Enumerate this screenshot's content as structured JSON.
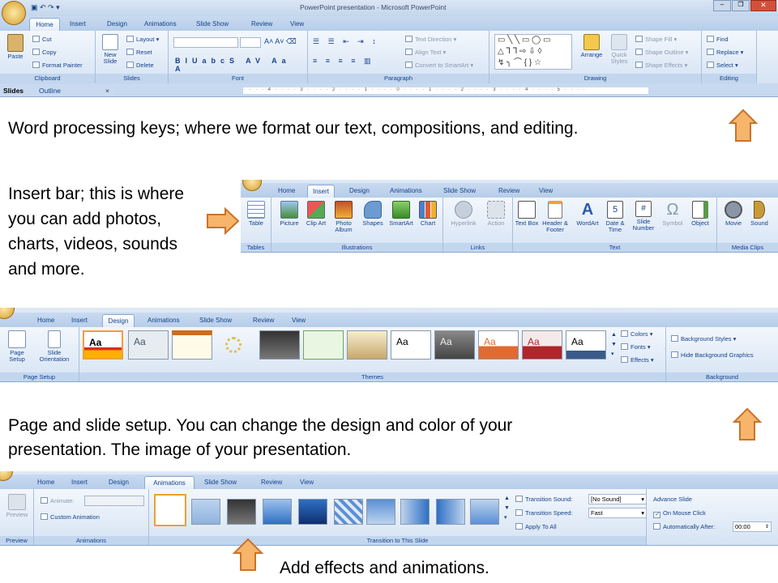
{
  "window": {
    "title": "PowerPoint presentation - Microsoft PowerPoint"
  },
  "ribbon1": {
    "tabs": [
      "Home",
      "Insert",
      "Design",
      "Animations",
      "Slide Show",
      "Review",
      "View"
    ],
    "clipboard": {
      "paste": "Paste",
      "cut": "Cut",
      "copy": "Copy",
      "format_painter": "Format Painter",
      "label": "Clipboard"
    },
    "slides": {
      "new_slide": "New Slide",
      "layout": "Layout",
      "reset": "Reset",
      "delete": "Delete",
      "label": "Slides"
    },
    "font": {
      "label": "Font"
    },
    "paragraph": {
      "text_direction": "Text Direction",
      "align_text": "Align Text",
      "convert": "Convert to SmartArt",
      "label": "Paragraph"
    },
    "drawing": {
      "arrange": "Arrange",
      "quick_styles": "Quick Styles",
      "shape_fill": "Shape Fill",
      "shape_outline": "Shape Outline",
      "shape_effects": "Shape Effects",
      "label": "Drawing"
    },
    "editing": {
      "find": "Find",
      "replace": "Replace",
      "select": "Select",
      "label": "Editing"
    },
    "pane_tabs": [
      "Slides",
      "Outline"
    ]
  },
  "text1": "Word processing keys; where we format our text, compositions, and editing.",
  "text2": [
    "Insert bar; this is where",
    "you can add photos,",
    "charts, videos, sounds",
    "and more."
  ],
  "ribbon2": {
    "tabs": [
      "Home",
      "Insert",
      "Design",
      "Animations",
      "Slide Show",
      "Review",
      "View"
    ],
    "buttons": [
      "Table",
      "Picture",
      "Clip Art",
      "Photo Album",
      "Shapes",
      "SmartArt",
      "Chart",
      "Hyperlink",
      "Action",
      "Text Box",
      "Header & Footer",
      "WordArt",
      "Date & Time",
      "Slide Number",
      "Symbol",
      "Object",
      "Movie",
      "Sound"
    ],
    "groups": [
      "Tables",
      "Illustrations",
      "Links",
      "Text",
      "Media Clips"
    ]
  },
  "ribbon3": {
    "tabs": [
      "Home",
      "Insert",
      "Design",
      "Animations",
      "Slide Show",
      "Review",
      "View"
    ],
    "page_setup": "Page Setup",
    "slide_orientation": "Slide Orientation",
    "group_page_setup": "Page Setup",
    "themes_label": "Themes",
    "theme_aa": "Aa",
    "colors": "Colors",
    "fonts": "Fonts",
    "effects": "Effects",
    "background_styles": "Background Styles",
    "hide_bg": "Hide Background Graphics",
    "group_background": "Background"
  },
  "text3": [
    "Page and slide setup. You can change the design and color of your",
    "presentation.  The image of your presentation."
  ],
  "ribbon4": {
    "tabs": [
      "Home",
      "Insert",
      "Design",
      "Animations",
      "Slide Show",
      "Review",
      "View"
    ],
    "preview": "Preview",
    "animate": "Animate:",
    "custom_animation": "Custom Animation",
    "group_preview": "Preview",
    "group_animations": "Animations",
    "transition_sound": "Transition Sound:",
    "sound_value": "[No Sound]",
    "transition_speed": "Transition Speed:",
    "speed_value": "Fast",
    "apply_all": "Apply To All",
    "advance_slide": "Advance Slide",
    "on_mouse_click": "On Mouse Click",
    "automatically_after": "Automatically After:",
    "time_value": "00:00",
    "group_transition": "Transition to This Slide"
  },
  "text4": "Add effects and animations.",
  "colors": {
    "arrow_fill": "#f7b46b",
    "arrow_stroke": "#c8732a"
  }
}
